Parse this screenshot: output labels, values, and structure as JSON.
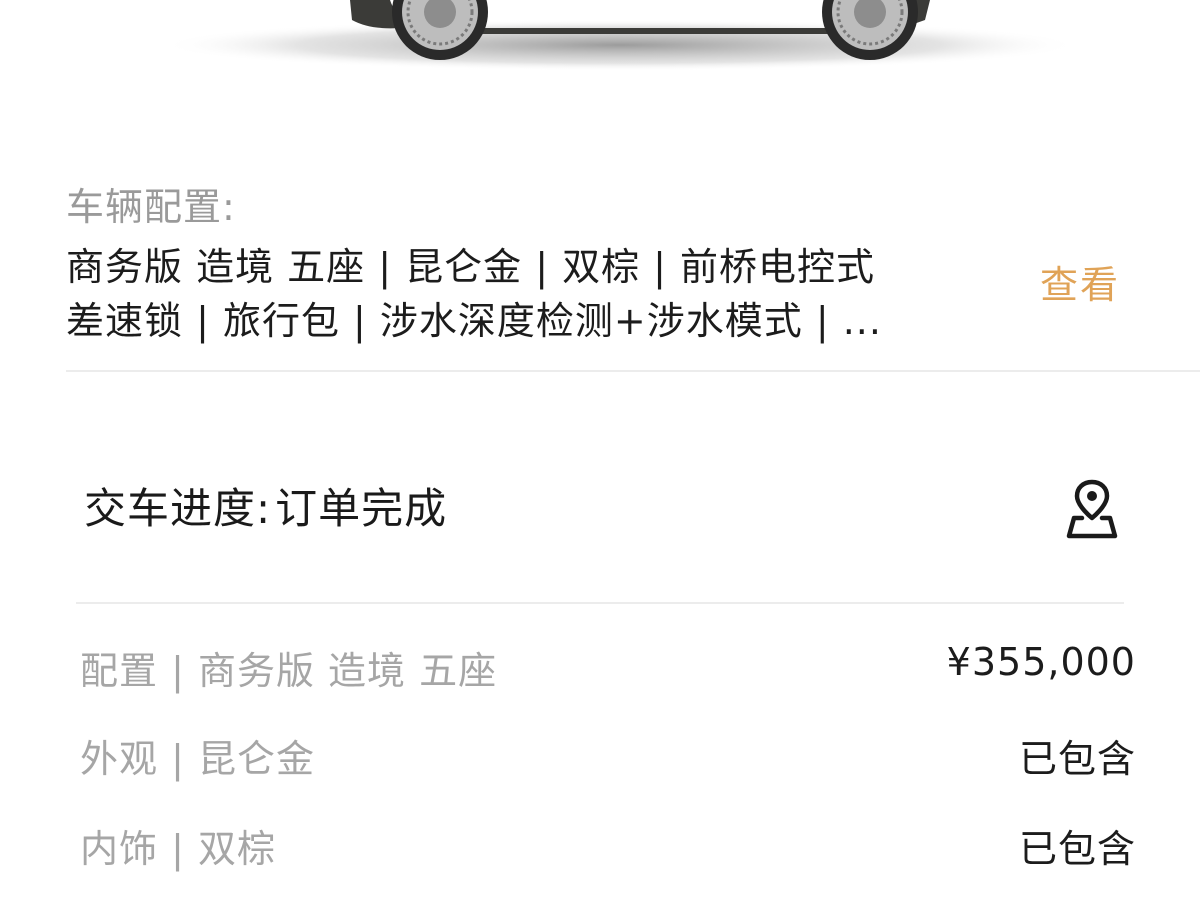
{
  "vehicle": {
    "image_icon": "car-image",
    "config_label": "车辆配置:",
    "config_line1": "商务版 造境 五座 | 昆仑金 | 双棕 | 前桥电控式",
    "config_line2": "差速锁 | 旅行包 | 涉水深度检测+涉水模式 | ...",
    "view_label": "查看"
  },
  "delivery": {
    "label": "交车进度:",
    "status": "订单完成",
    "icon": "map-pin-icon"
  },
  "items": [
    {
      "label": "配置 | 商务版 造境 五座",
      "value": "¥355,000"
    },
    {
      "label": "外观 | 昆仑金",
      "value": "已包含"
    },
    {
      "label": "内饰 | 双棕",
      "value": "已包含"
    }
  ],
  "colors": {
    "accent": "#e0a357",
    "muted_text": "#9a9a9a",
    "primary_text": "#1c1c1c",
    "divider": "#ececec"
  }
}
